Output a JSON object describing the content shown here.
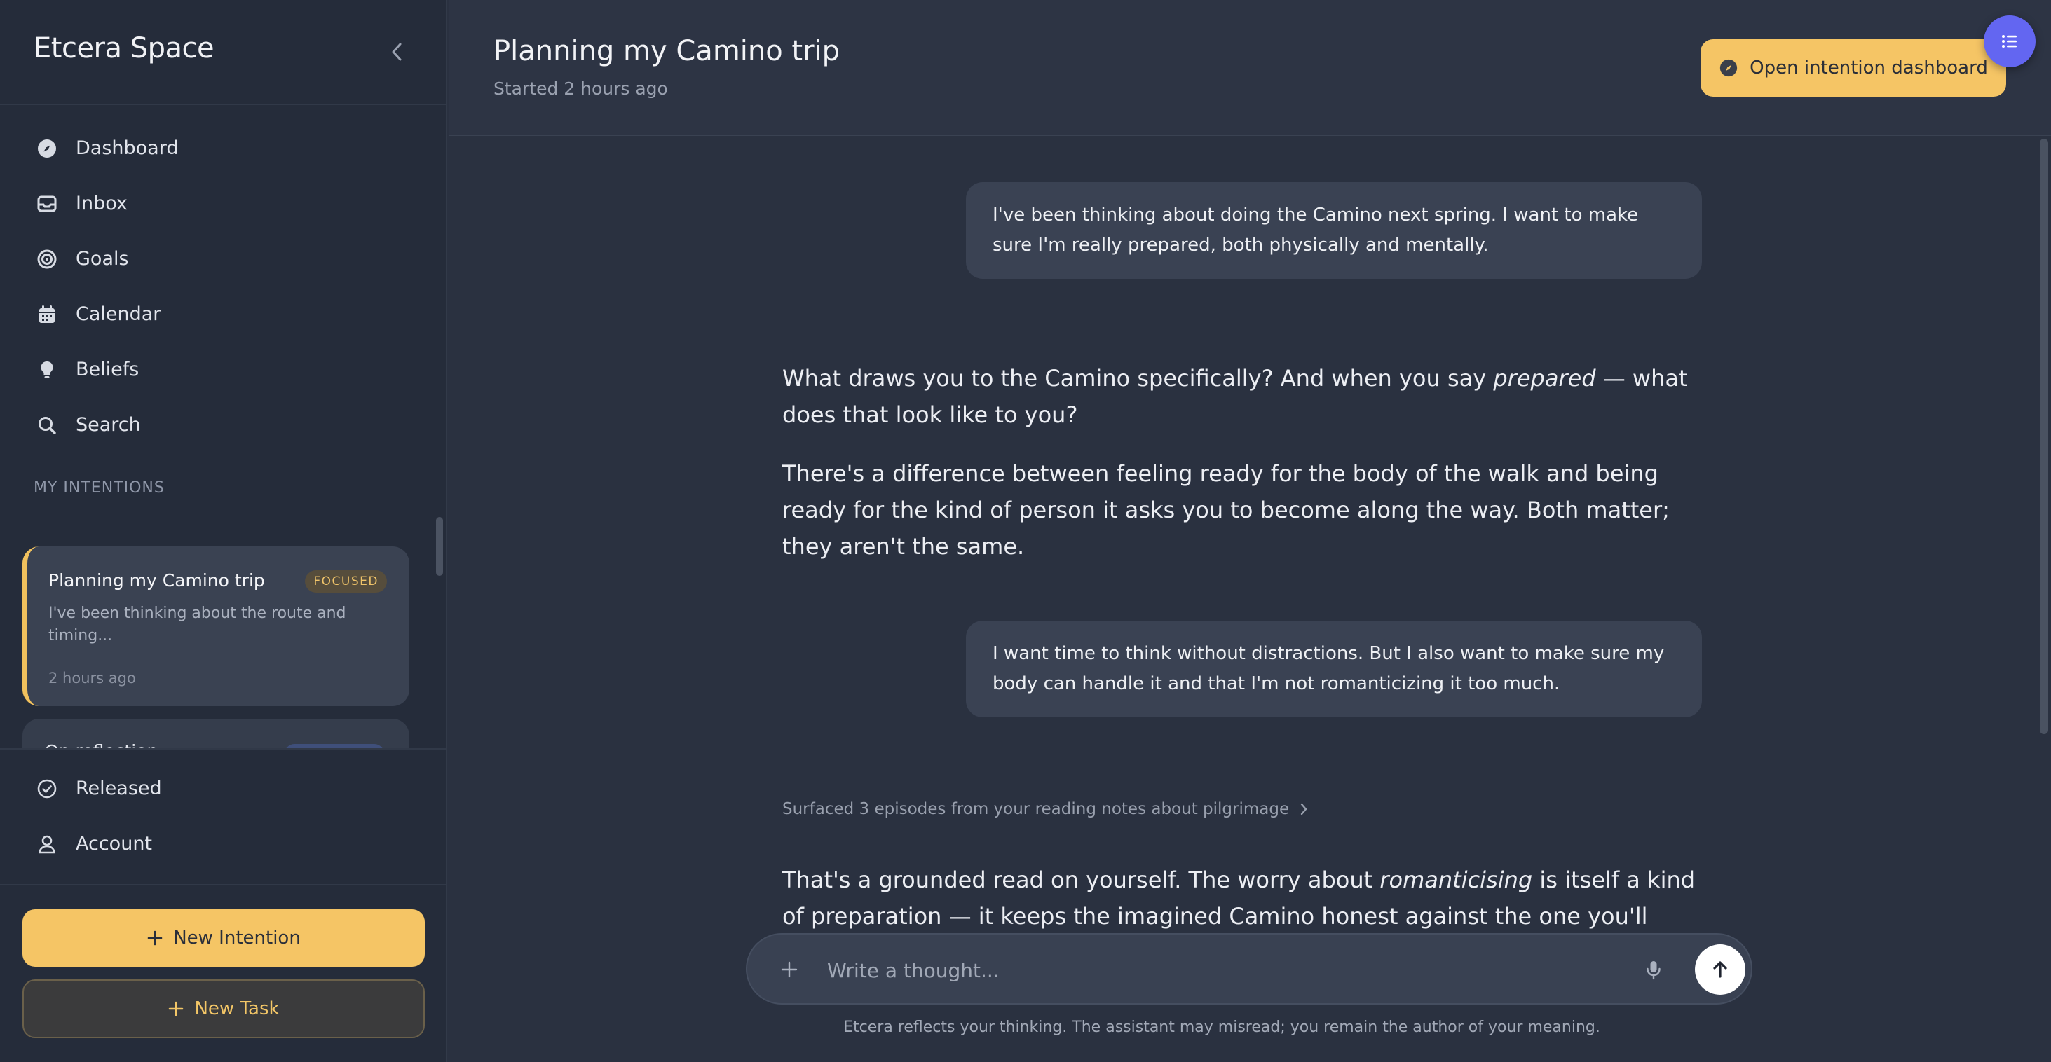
{
  "sidebar": {
    "brand": "Etcera Space",
    "nav": [
      {
        "label": "Dashboard",
        "icon": "compass-icon"
      },
      {
        "label": "Inbox",
        "icon": "inbox-icon"
      },
      {
        "label": "Goals",
        "icon": "target-icon"
      },
      {
        "label": "Calendar",
        "icon": "calendar-icon"
      },
      {
        "label": "Beliefs",
        "icon": "lightbulb-icon"
      },
      {
        "label": "Search",
        "icon": "search-icon"
      }
    ],
    "section_label": "MY INTENTIONS",
    "intentions": [
      {
        "title": "Planning my Camino trip",
        "badge": "FOCUSED",
        "excerpt": "I've been thinking about the route and timing...",
        "ago": "2 hours ago"
      },
      {
        "title": "On reflection"
      }
    ],
    "bottom_nav": [
      {
        "label": "Released",
        "icon": "check-circle-icon"
      },
      {
        "label": "Account",
        "icon": "user-icon"
      }
    ],
    "new_intention": "New Intention",
    "new_task": "New Task"
  },
  "header": {
    "title": "Planning my Camino trip",
    "subtitle": "Started 2 hours ago",
    "dashboard_button": "Open intention dashboard"
  },
  "chat": {
    "user_1": "I've been thinking about doing the Camino next spring. I want to make sure I'm really prepared, both physically and mentally.",
    "assistant_1a_pre": "What draws you to the Camino specifically? And when you say ",
    "assistant_1a_em": "prepared",
    "assistant_1a_post": " — what does that look like to you?",
    "assistant_1b": "There's a difference between feeling ready for the body of the walk and being ready for the kind of person it asks you to become along the way. Both matter; they aren't the same.",
    "user_2": "I want time to think without distractions. But I also want to make sure my body can handle it and that I'm not romanticizing it too much.",
    "surfaced": "Surfaced 3 episodes from your reading notes about pilgrimage",
    "assistant_2_pre": "That's a grounded read on yourself. The worry about ",
    "assistant_2_em": "romanticising",
    "assistant_2_post": " is itself a kind of preparation — it keeps the imagined Camino honest against the one you'll actually walk."
  },
  "composer": {
    "placeholder": "Write a thought...",
    "disclaimer": "Etcera reflects your thinking. The assistant may misread; you remain the author of your meaning."
  },
  "colors": {
    "accent": "#f5c565",
    "fab": "#6366f1",
    "bg": "#2a3140",
    "sidebar": "#252c3a"
  }
}
